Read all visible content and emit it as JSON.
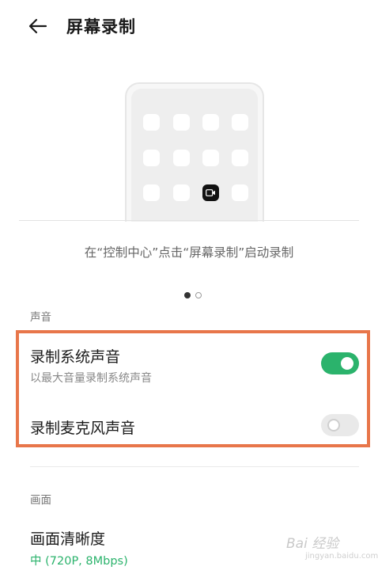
{
  "header": {
    "title": "屏幕录制"
  },
  "illustration": {
    "caption": "在“控制中心”点击“屏幕录制”启动录制",
    "page_count": 2,
    "active_page": 1
  },
  "sound_section": {
    "label": "声音",
    "items": [
      {
        "title": "录制系统声音",
        "subtitle": "以最大音量录制系统声音",
        "enabled": true
      },
      {
        "title": "录制麦克风声音",
        "enabled": false
      }
    ]
  },
  "picture_section": {
    "label": "画面",
    "items": [
      {
        "title": "画面清晰度",
        "value": "中 (720P, 8Mbps)"
      }
    ]
  },
  "watermark": {
    "brand": "Bai 经验",
    "url": "jingyan.baidu.com"
  },
  "colors": {
    "accent": "#2bb36c",
    "highlight": "#e8764a"
  }
}
